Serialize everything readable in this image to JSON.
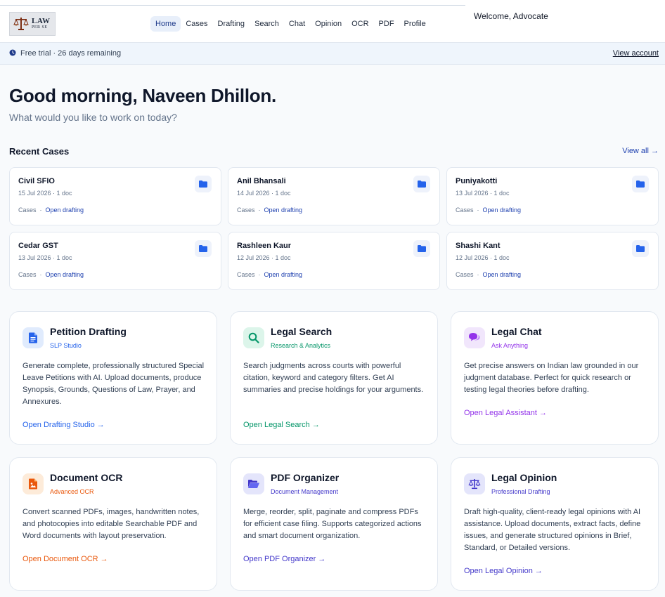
{
  "header": {
    "logo": {
      "line1": "LAW",
      "line2": "PER SE"
    },
    "nav": [
      {
        "label": "Home"
      },
      {
        "label": "Cases"
      },
      {
        "label": "Drafting"
      },
      {
        "label": "Search"
      },
      {
        "label": "Chat"
      },
      {
        "label": "Opinion"
      },
      {
        "label": "OCR"
      },
      {
        "label": "PDF"
      },
      {
        "label": "Profile"
      }
    ],
    "welcome": "Welcome, Advocate"
  },
  "trial": {
    "text": "Free trial · 26 days remaining",
    "link": "View account"
  },
  "greeting": {
    "title": "Good morning, Naveen Dhillon.",
    "subtitle": "What would you like to work on today?"
  },
  "recent": {
    "title": "Recent Cases",
    "view_all": "View all →",
    "cases": [
      {
        "name": "Civil SFIO",
        "meta": "15 Jul 2026 · 1 doc",
        "tag": "Cases",
        "dot": "·",
        "action": "Open drafting"
      },
      {
        "name": "Anil Bhansali",
        "meta": "14 Jul 2026 · 1 doc",
        "tag": "Cases",
        "dot": "·",
        "action": "Open drafting"
      },
      {
        "name": "Puniyakotti",
        "meta": "13 Jul 2026 · 1 doc",
        "tag": "Cases",
        "dot": "·",
        "action": "Open drafting"
      },
      {
        "name": "Cedar GST",
        "meta": "13 Jul 2026 · 1 doc",
        "tag": "Cases",
        "dot": "·",
        "action": "Open drafting"
      },
      {
        "name": "Rashleen Kaur",
        "meta": "12 Jul 2026 · 1 doc",
        "tag": "Cases",
        "dot": "·",
        "action": "Open drafting"
      },
      {
        "name": "Shashi Kant",
        "meta": "12 Jul 2026 · 1 doc",
        "tag": "Cases",
        "dot": "·",
        "action": "Open drafting"
      }
    ]
  },
  "tools": [
    {
      "title": "Petition Drafting",
      "subtitle": "SLP Studio",
      "desc": "Generate complete, professionally structured Special Leave Petitions with AI. Upload documents, produce Synopsis, Grounds, Questions of Law, Prayer, and Annexures.",
      "link": "Open Drafting Studio →",
      "icon": "document-icon",
      "accent": "#2563eb",
      "icon_bg": "#e0ebfd"
    },
    {
      "title": "Legal Search",
      "subtitle": "Research & Analytics",
      "desc": "Search judgments across courts with powerful citation, keyword and category filters. Get AI summaries and precise holdings for your arguments.",
      "link": "Open Legal Search →",
      "icon": "search-icon",
      "accent": "#059669",
      "icon_bg": "#dcf5ea"
    },
    {
      "title": "Legal Chat",
      "subtitle": "Ask Anything",
      "desc": "Get precise answers on Indian law grounded in our judgment database. Perfect for quick research or testing legal theories before drafting.",
      "link": "Open Legal Assistant →",
      "icon": "chat-icon",
      "accent": "#9333ea",
      "icon_bg": "#f1e6fc"
    },
    {
      "title": "Document OCR",
      "subtitle": "Advanced OCR",
      "desc": "Convert scanned PDFs, images, handwritten notes, and photocopies into editable Searchable PDF and Word documents with layout preservation.",
      "link": "Open Document OCR →",
      "icon": "image-file-icon",
      "accent": "#ea580c",
      "icon_bg": "#fdebd9"
    },
    {
      "title": "PDF Organizer",
      "subtitle": "Document Management",
      "desc": "Merge, reorder, split, paginate and compress PDFs for efficient case filing. Supports categorized actions and smart document organization.",
      "link": "Open PDF Organizer →",
      "icon": "folder-open-icon",
      "accent": "#4338ca",
      "icon_bg": "#e4e5fb"
    },
    {
      "title": "Legal Opinion",
      "subtitle": "Professional Drafting",
      "desc": "Draft high-quality, client-ready legal opinions with AI assistance. Upload documents, extract facts, define issues, and generate structured opinions in Brief, Standard, or Detailed versions.",
      "link": "Open Legal Opinion →",
      "icon": "scales-icon",
      "accent": "#4338ca",
      "icon_bg": "#e4e5fb"
    }
  ]
}
